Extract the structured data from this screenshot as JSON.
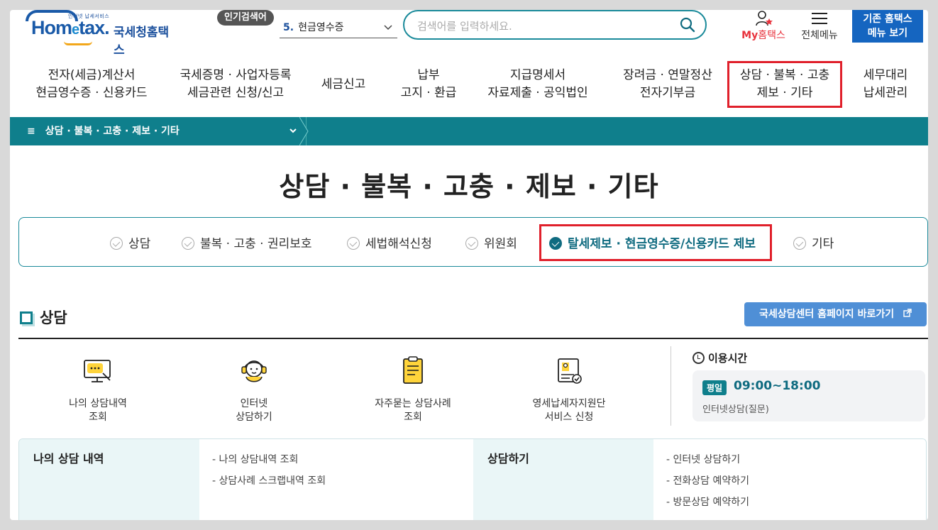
{
  "header": {
    "logo_small": "인터넷 납세서비스",
    "logo_main": "Hom",
    "logo_e": "e",
    "logo_tax": "tax.",
    "logo_name": "국세청홈택스",
    "popular_tag": "인기검색어",
    "popular_rank_num": "5.",
    "popular_rank_text": "현금영수증",
    "search_placeholder": "검색어를 입력하세요.",
    "my_label_prefix": "My",
    "my_label": "홈택스",
    "menu_all_label": "전체메뉴",
    "old_btn_line1": "기존 홈택스",
    "old_btn_line2": "메뉴 보기"
  },
  "gnb": [
    {
      "line1": "전자(세금)계산서",
      "line2": "현금영수증 · 신용카드"
    },
    {
      "line1": "국세증명 · 사업자등록",
      "line2": "세금관련 신청/신고"
    },
    {
      "line1": "세금신고",
      "line2": ""
    },
    {
      "line1": "납부",
      "line2": "고지 · 환급"
    },
    {
      "line1": "지급명세서",
      "line2": "자료제출 · 공익법인"
    },
    {
      "line1": "장려금 · 연말정산",
      "line2": "전자기부금"
    },
    {
      "line1": "상담 · 불복 · 고충",
      "line2": "제보 · 기타"
    },
    {
      "line1": "세무대리",
      "line2": "납세관리"
    }
  ],
  "breadcrumb": {
    "label": "상담 · 불복 · 고충 · 제보 · 기타"
  },
  "page_title": "상담 · 불복 · 고충 · 제보 · 기타",
  "subtabs": [
    {
      "label": "상담"
    },
    {
      "label": "불복 · 고충 · 권리보호"
    },
    {
      "label": "세법해석신청"
    },
    {
      "label": "위원회"
    },
    {
      "label": "탈세제보 · 현금영수증/신용카드 제보"
    },
    {
      "label": "기타"
    }
  ],
  "section": {
    "title": "상담",
    "ext_button": "국세상담센터 홈페이지 바로가기"
  },
  "services": [
    {
      "line1": "나의 상담내역",
      "line2": "조회",
      "icon": "monitor-chat-icon"
    },
    {
      "line1": "인터넷",
      "line2": "상담하기",
      "icon": "headset-agent-icon"
    },
    {
      "line1": "자주묻는 상담사례",
      "line2": "조회",
      "icon": "clipboard-icon"
    },
    {
      "line1": "영세납세자지원단",
      "line2": "서비스 신청",
      "icon": "certificate-scroll-icon"
    }
  ],
  "hours": {
    "title": "이용시간",
    "badge": "평일",
    "time": "09:00~18:00",
    "note": "인터넷상담(질문)"
  },
  "bottom": {
    "col1_title": "나의 상담 내역",
    "col1_links": [
      "- 나의 상담내역 조회",
      "- 상담사례 스크랩내역 조회"
    ],
    "col2_title": "상담하기",
    "col2_links": [
      "- 인터넷 상담하기",
      "- 전화상담 예약하기",
      "- 방문상담 예약하기"
    ]
  },
  "colors": {
    "teal": "#0f7f8c",
    "highlight_red": "#e0202b",
    "brand_blue": "#1565c0"
  }
}
